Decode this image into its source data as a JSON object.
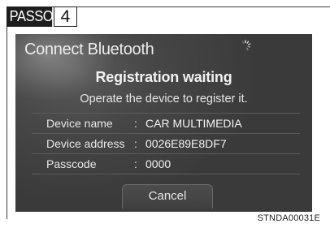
{
  "step": {
    "word": "PASSO",
    "number": "4"
  },
  "screen": {
    "title": "Connect Bluetooth",
    "status_title": "Registration waiting",
    "instruction": "Operate the device to register it.",
    "details": [
      {
        "label": "Device name",
        "value": "CAR MULTIMEDIA"
      },
      {
        "label": "Device address",
        "value": "0026E89E8DF7"
      },
      {
        "label": "Passcode",
        "value": "0000"
      }
    ],
    "separator": ":",
    "cancel_label": "Cancel",
    "busy_indicator": "spinner-icon"
  },
  "image_code": "STNDA00031E",
  "colors": {
    "screen_background": "#464646",
    "text": "#ececec",
    "step_badge": "#1e1e1e"
  }
}
